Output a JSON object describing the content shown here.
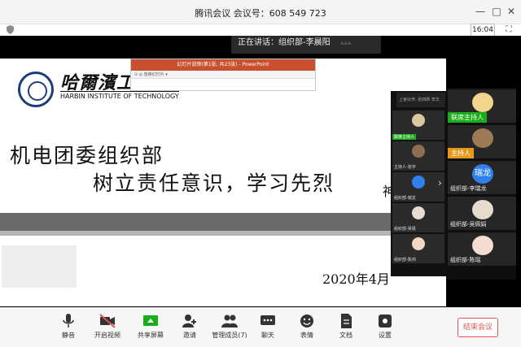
{
  "window": {
    "title": "腾讯会议 会议号：608 549 723",
    "minimize_glyph": "—",
    "maximize_glyph": "□",
    "close_glyph": "✕"
  },
  "subbar": {
    "timer": "16:04",
    "fullscreen_glyph": "⛶"
  },
  "speaking": {
    "text": "正在讲话：组织部-李晨阳",
    "wave_glyph": "▴▴▴"
  },
  "slide": {
    "logo_cn": "哈爾濱工業大",
    "logo_en": "HARBIN INSTITUTE OF TECHNOLOGY",
    "ppt_title": "幻灯片放映(第1张, 共23张) - PowerPoint",
    "ppt_ribbon": "⊙ ◎ 放映幻灯片 ▾",
    "heading1": "机电团委组织部",
    "heading2": "树立责任意识，学习先烈",
    "heading2_tail": "神",
    "date": "2020年4月"
  },
  "participants_small": [
    {
      "name": "上官仪传: 张四新·李华",
      "tag": ""
    },
    {
      "name": "联席主持人",
      "tag": "联席主持人"
    },
    {
      "name": "主持人-张宇",
      "tag": ""
    },
    {
      "name": "组织部-瑞龙",
      "tag": ""
    },
    {
      "name": "组织部-吴佩",
      "tag": ""
    },
    {
      "name": "组织部-陈帅",
      "tag": ""
    }
  ],
  "participants_large": [
    {
      "name": "联席主持人",
      "type": "cohost",
      "initial": ""
    },
    {
      "name": "组织部-李晨阳",
      "type": "host",
      "tag": "主持人",
      "initial": ""
    },
    {
      "name": "组织部-李瑞龙",
      "type": "normal",
      "initial": "瑞龙"
    },
    {
      "name": "组织部-吴佩娟",
      "type": "normal",
      "initial": ""
    },
    {
      "name": "组织部-陈瑶",
      "type": "normal",
      "initial": ""
    }
  ],
  "toolbar": {
    "items": [
      {
        "label": "静音",
        "icon": "microphone-icon"
      },
      {
        "label": "开启视频",
        "icon": "video-off-icon"
      },
      {
        "label": "共享屏幕",
        "icon": "share-screen-icon"
      },
      {
        "label": "邀请",
        "icon": "invite-icon"
      },
      {
        "label": "管理成员(7)",
        "icon": "members-icon"
      },
      {
        "label": "聊天",
        "icon": "chat-icon"
      },
      {
        "label": "表情",
        "icon": "emoji-icon"
      },
      {
        "label": "文档",
        "icon": "document-icon"
      },
      {
        "label": "设置",
        "icon": "settings-icon"
      }
    ],
    "end_label": "结束会议"
  },
  "colors": {
    "host_green": "#1aad19",
    "host_orange": "#e69a1c",
    "end_red": "#e05353",
    "share_green": "#1aad19"
  }
}
